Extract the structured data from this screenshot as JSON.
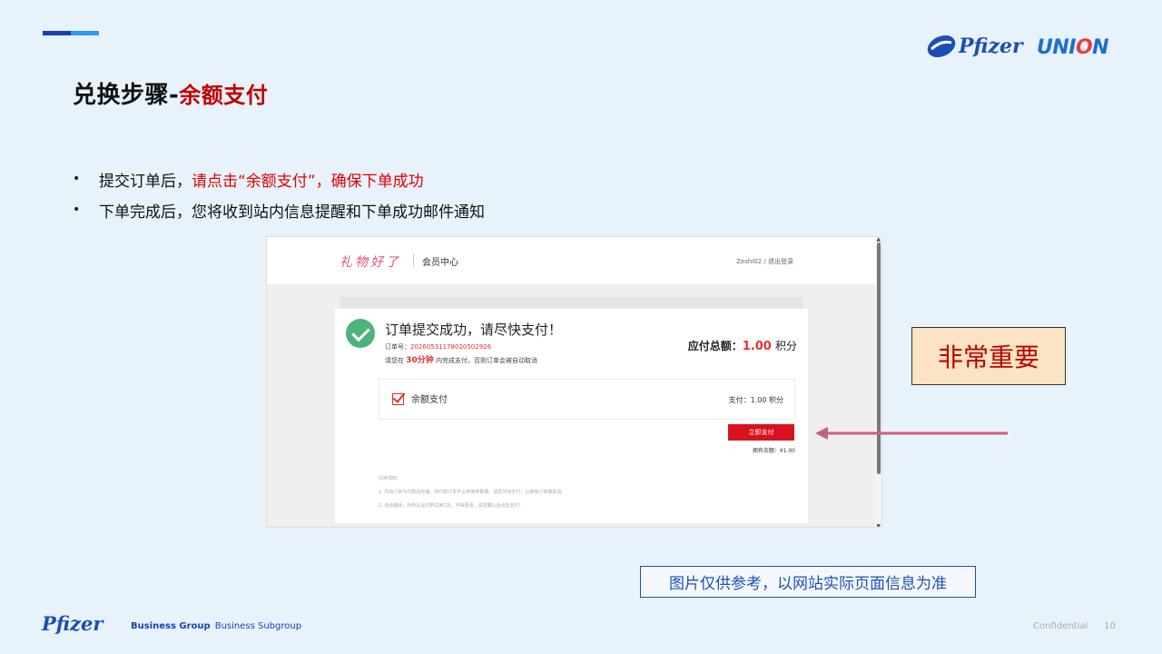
{
  "slide": {
    "title_main": "兑换步骤-",
    "title_highlight": "余额支付",
    "logos": {
      "pfizer": "Pfizer",
      "union_prefix": "UNI",
      "union_o": "O",
      "union_suffix": "N"
    },
    "bullets": [
      {
        "bullet": "•",
        "text": "提交订单后，",
        "highlight": "请点击“余额支付”，确保下单成功"
      },
      {
        "bullet": "•",
        "text": "下单完成后，您将收到站内信息提醒和下单成功邮件通知",
        "highlight": ""
      }
    ],
    "important_label": "非常重要",
    "reference_note": "图片仅供参考，以网站实际页面信息为准",
    "footer": {
      "logo": "Pfizer",
      "group": "Business Group",
      "subgroup": "Business Subgroup",
      "confidential": "Confidential",
      "page_number": "10"
    },
    "colors": {
      "accent_dark": "#1a3fb5",
      "accent_light": "#2b9bf0",
      "highlight_red": "#c00000",
      "important_bg": "#fbe3c3"
    }
  },
  "screenshot": {
    "brand": "礼物好了",
    "member_center": "会员中心",
    "user": "Zeshi02",
    "user_sep": "/",
    "logout": "退出登录",
    "success_title": "订单提交成功，请尽快支付！",
    "order_no_label": "订单号：",
    "order_no": "20260531178020502926",
    "countdown_prefix": "请您在",
    "countdown_time": "30分钟",
    "countdown_suffix": "内完成支付，否则订单会被自动取消",
    "total_label": "应付总额：",
    "total_amount": "1.00",
    "total_unit": "积分",
    "pay_method": "余额支付",
    "pay_amount": "支付：1.00 积分",
    "pay_button": "立即支付",
    "balance": "拥有余额：¥1.00",
    "notes_title": "兑换须知:",
    "note_1": "1. 所有订单为付款后存储，待付款订单不占用库存数量，请您尽快支付，以避免订单被取消。",
    "note_2": "2. 活动期间，所有礼品仅限兑换1次，不得更改，请您确认后点击支付!"
  }
}
